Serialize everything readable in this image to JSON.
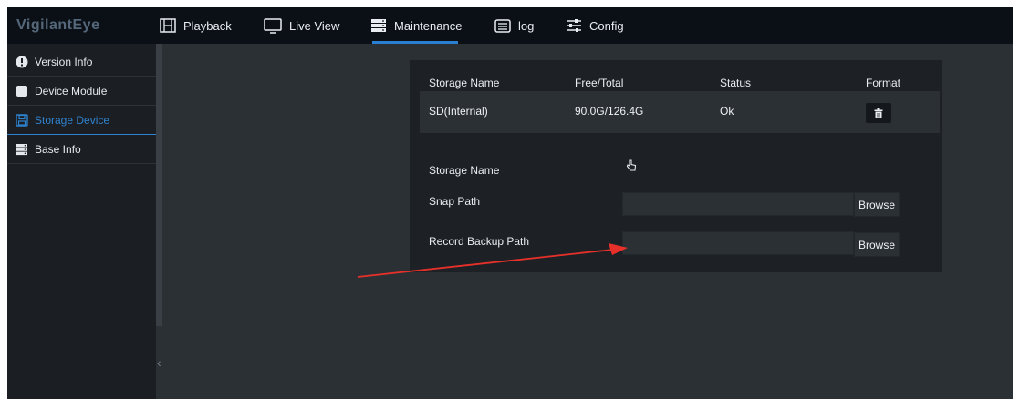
{
  "brand": "VigilantEye",
  "nav": [
    {
      "label": "Playback",
      "icon": "film-icon"
    },
    {
      "label": "Live View",
      "icon": "monitor-icon"
    },
    {
      "label": "Maintenance",
      "icon": "server-icon",
      "active": true
    },
    {
      "label": "log",
      "icon": "list-icon"
    },
    {
      "label": "Config",
      "icon": "sliders-icon"
    }
  ],
  "sidebar": {
    "items": [
      {
        "label": "Version Info",
        "icon": "info-icon"
      },
      {
        "label": "Device Module",
        "icon": "square-icon"
      },
      {
        "label": "Storage Device",
        "icon": "floppy-icon",
        "active": true
      },
      {
        "label": "Base Info",
        "icon": "server-icon"
      }
    ]
  },
  "storage_table": {
    "headers": [
      "Storage Name",
      "Free/Total",
      "Status",
      "Format"
    ],
    "rows": [
      {
        "name": "SD(Internal)",
        "free_total": "90.0G/126.4G",
        "status": "Ok",
        "format_icon": "trash-icon"
      }
    ]
  },
  "paths": {
    "storage_name_label": "Storage Name",
    "storage_name_icon": "hand-pointer-icon",
    "snap_path_label": "Snap Path",
    "snap_path_value": "",
    "record_backup_label": "Record Backup Path",
    "record_backup_value": "",
    "browse_label": "Browse"
  },
  "annotation": {
    "type": "red-arrow",
    "color": "#e8302a"
  },
  "colors": {
    "accent": "#2b7fd0",
    "topbar": "#0b1017",
    "sidebar": "#1b1f23",
    "content": "#2b3035",
    "panel": "#1d2125"
  }
}
